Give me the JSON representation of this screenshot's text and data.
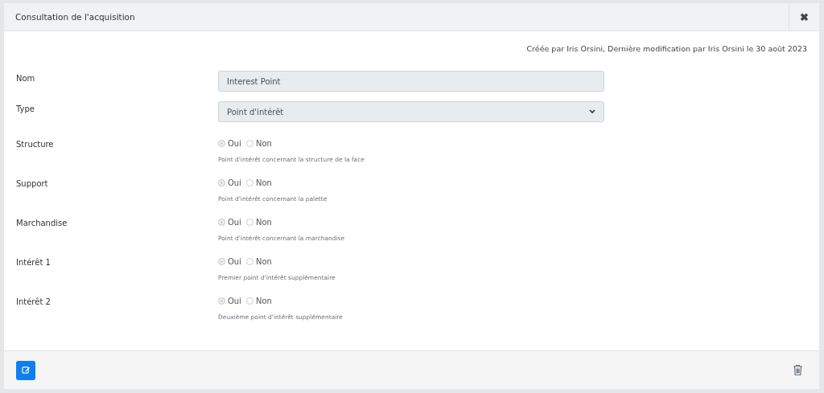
{
  "dialog": {
    "title": "Consultation de l'acquisition",
    "close": "✖"
  },
  "meta": "Créée par Iris Orsini, Dernière modification par Iris Orsini le 30 août 2023",
  "fields": [
    {
      "kind": "text",
      "label": "Nom",
      "value": "Interest Point"
    },
    {
      "kind": "select",
      "label": "Type",
      "value": "Point d'intérêt"
    },
    {
      "kind": "radio",
      "label": "Structure",
      "disabled": true,
      "options": [
        {
          "label": "Oui",
          "selected": true
        },
        {
          "label": "Non",
          "selected": false
        }
      ],
      "help": "Point d'intérêt concernant la structure de la face"
    },
    {
      "kind": "radio",
      "label": "Support",
      "disabled": true,
      "options": [
        {
          "label": "Oui",
          "selected": true
        },
        {
          "label": "Non",
          "selected": false
        }
      ],
      "help": "Point d'intérêt concernant la palette"
    },
    {
      "kind": "radio",
      "label": "Marchandise",
      "disabled": true,
      "options": [
        {
          "label": "Oui",
          "selected": true
        },
        {
          "label": "Non",
          "selected": false
        }
      ],
      "help": "Point d'intérêt concernant la marchandise"
    },
    {
      "kind": "radio",
      "label": "Intérêt 1",
      "disabled": true,
      "options": [
        {
          "label": "Oui",
          "selected": true
        },
        {
          "label": "Non",
          "selected": false
        }
      ],
      "help": "Premier point d'intérêt supplémentaire"
    },
    {
      "kind": "radio",
      "label": "Intérêt 2",
      "disabled": true,
      "options": [
        {
          "label": "Oui",
          "selected": true
        },
        {
          "label": "Non",
          "selected": false
        }
      ],
      "help": "Deuxième point d'intérêt supplémentaire"
    }
  ]
}
